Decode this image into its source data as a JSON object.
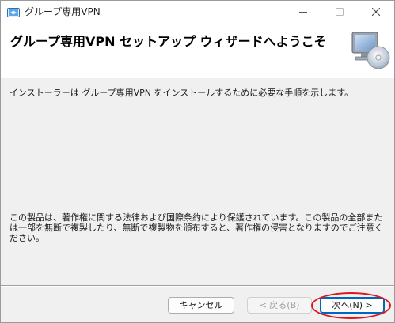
{
  "window": {
    "title": "グループ専用VPN"
  },
  "header": {
    "title": "グループ専用VPN セットアップ ウィザードへようこそ",
    "graphic_icon": "computer-cd-icon"
  },
  "body": {
    "intro": "インストーラーは グループ専用VPN をインストールするために必要な手順を示します。",
    "copyright": "この製品は、著作権に関する法律および国際条約により保護されています。この製品の全部または一部を無断で複製したり、無断で複製物を頒布すると、著作権の侵害となりますのでご注意ください。"
  },
  "footer": {
    "cancel_label": "キャンセル",
    "back_label": "< 戻る(B)",
    "next_label": "次へ(N) >"
  },
  "colors": {
    "accent": "#0067c0",
    "highlight": "#e0151c",
    "dialog_bg": "#f0f0f0"
  }
}
